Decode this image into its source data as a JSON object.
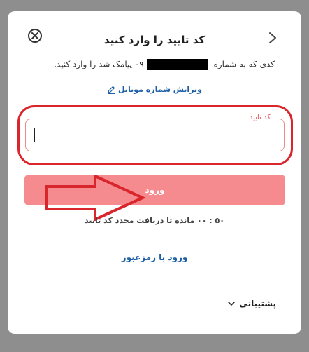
{
  "modal": {
    "title": "کد تایید را وارد کنید",
    "subtitle_before": "کدی که به شماره ",
    "subtitle_phone_prefix": "۰۹",
    "subtitle_after": " پیامک شد را وارد کنید.",
    "edit_mobile_label": "ویرایش شماره موبایل",
    "code_field_label": "کد تایید",
    "code_value": "",
    "submit_label": "ورود",
    "timer_text": "۵۰ : ۰۰ مانده تا دریافت مجدد کد تایید",
    "password_login_label": "ورود با رمزعبور",
    "support_label": "پشتیبانی"
  },
  "icons": {
    "close": "close-circle-icon",
    "back": "chevron-right-icon",
    "edit": "pencil-icon",
    "support_chevron": "chevron-down-icon",
    "annotation_arrow": "arrow-annotation-icon"
  },
  "colors": {
    "accent": "#1c5fa7",
    "button_disabled": "#f68b8f",
    "annotation_red": "#d9252c",
    "field_label": "#e0585b"
  }
}
